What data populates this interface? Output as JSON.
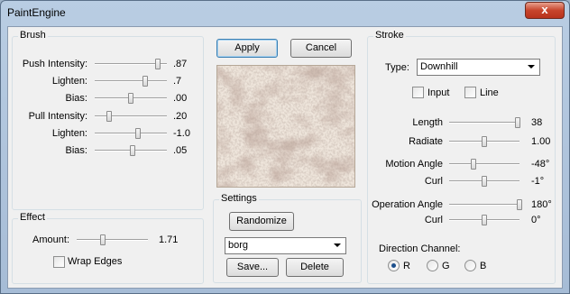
{
  "window": {
    "title": "PaintEngine",
    "close_glyph": "x"
  },
  "actions": {
    "apply": "Apply",
    "cancel": "Cancel"
  },
  "brush": {
    "title": "Brush",
    "rows": [
      {
        "label": "Push Intensity:",
        "value": ".87",
        "level": 0.87
      },
      {
        "label": "Lighten:",
        "value": ".7",
        "level": 0.7
      },
      {
        "label": "Bias:",
        "value": ".00",
        "level": 0.5
      },
      {
        "label": "Pull Intensity:",
        "value": ".20",
        "level": 0.2
      },
      {
        "label": "Lighten:",
        "value": "-1.0",
        "level": 0.6
      },
      {
        "label": "Bias:",
        "value": ".05",
        "level": 0.52
      }
    ]
  },
  "effect": {
    "title": "Effect",
    "amount_label": "Amount:",
    "amount_value": "1.71",
    "amount_level": 0.37,
    "wrap_edges_label": "Wrap Edges",
    "wrap_edges_checked": false
  },
  "preview": {
    "colors": [
      "#efe6dc",
      "#9c7c6c",
      "#d8c8b8",
      "#6e5448"
    ]
  },
  "settings": {
    "title": "Settings",
    "randomize": "Randomize",
    "preset": "borg",
    "save": "Save...",
    "delete": "Delete"
  },
  "stroke": {
    "title": "Stroke",
    "type_label": "Type:",
    "type_value": "Downhill",
    "input_label": "Input",
    "input_checked": false,
    "line_label": "Line",
    "line_checked": false,
    "rows": [
      {
        "label": "Length",
        "value": "38",
        "level": 0.97
      },
      {
        "label": "Radiate",
        "value": "1.00",
        "level": 0.5
      },
      {
        "label": "Motion Angle",
        "value": "-48°",
        "level": 0.34
      },
      {
        "label": "Curl",
        "value": "-1°",
        "level": 0.5
      },
      {
        "label": "Operation Angle",
        "value": "180°",
        "level": 1.0
      },
      {
        "label": "Curl",
        "value": "0°",
        "level": 0.5
      }
    ],
    "direction_label": "Direction Channel:",
    "channels": [
      {
        "label": "R",
        "selected": true
      },
      {
        "label": "G",
        "selected": false
      },
      {
        "label": "B",
        "selected": false
      }
    ]
  }
}
